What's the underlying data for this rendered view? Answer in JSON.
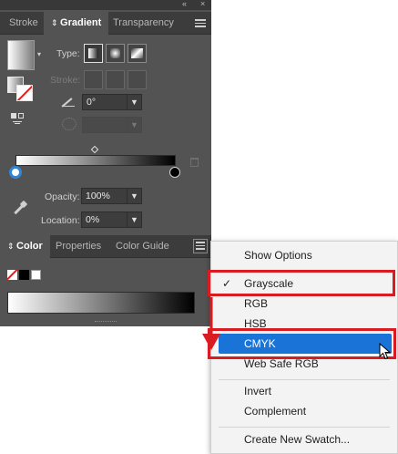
{
  "gradient_panel": {
    "collapse_glyph": "«",
    "close_glyph": "×",
    "tabs": [
      {
        "label": "Stroke"
      },
      {
        "label": "Gradient"
      },
      {
        "label": "Transparency"
      }
    ],
    "type_label": "Type:",
    "stroke_label": "Stroke:",
    "angle_value": "0°",
    "opacity_label": "Opacity:",
    "opacity_value": "100%",
    "location_label": "Location:",
    "location_value": "0%"
  },
  "color_panel": {
    "tabs": [
      {
        "label": "Color"
      },
      {
        "label": "Properties"
      },
      {
        "label": "Color Guide"
      }
    ]
  },
  "context_menu": {
    "check_glyph": "✓",
    "items": [
      {
        "label": "Show Options"
      },
      {
        "label": "Grayscale",
        "checked": true
      },
      {
        "label": "RGB"
      },
      {
        "label": "HSB"
      },
      {
        "label": "CMYK",
        "highlighted": true
      },
      {
        "label": "Web Safe RGB"
      },
      {
        "label": "Invert"
      },
      {
        "label": "Complement"
      },
      {
        "label": "Create New Swatch..."
      }
    ]
  },
  "colors": {
    "panel_bg": "#535353",
    "highlight": "#1a74d8",
    "annotation_red": "#d81c22"
  }
}
